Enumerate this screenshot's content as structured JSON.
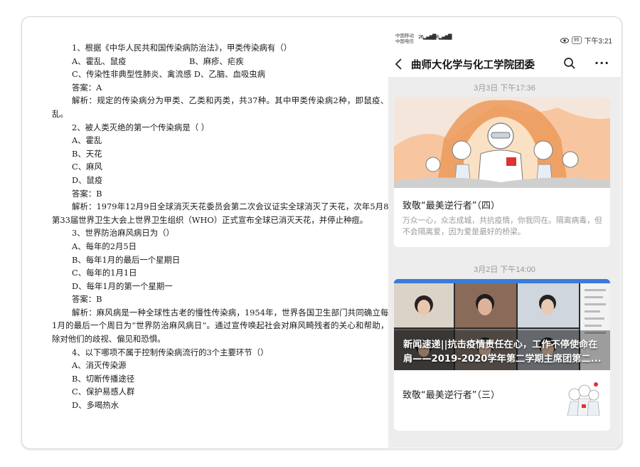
{
  "document": {
    "lines": [
      {
        "t": "1、根据《中华人民共和国传染病防治法》，甲类传染病有（）",
        "indent": true
      },
      {
        "t": "A、霍乱、鼠疫",
        "t2": "B、麻疹、疟疾",
        "indent": true
      },
      {
        "t": "C、传染性非典型性肺炎、禽流感    D、乙脑、血吸虫病",
        "indent": true
      },
      {
        "t": "答案：A",
        "indent": true
      },
      {
        "t": "解析：规定的传染病分为甲类、乙类和丙类，共37种。其中甲类传染病2种，即鼠疫、霍乱。",
        "wrap": true
      },
      {
        "t": "2、被人类灭绝的第一个传染病是（ ）",
        "indent": true
      },
      {
        "t": "A、霍乱",
        "indent": true
      },
      {
        "t": "B、天花",
        "indent": true
      },
      {
        "t": "C、麻风",
        "indent": true
      },
      {
        "t": "D、鼠疫",
        "indent": true
      },
      {
        "t": "答案：B",
        "indent": true
      },
      {
        "t": "解析：1979年12月9日全球消灭天花委员会第二次会议证实全球消灭了天花，次年5月8日第33届世界卫生大会上世界卫生组织（WHO）正式宣布全球已消灭天花，并停止种痘。",
        "wrap": true
      },
      {
        "t": "3、世界防治麻风病日为（）",
        "indent": true
      },
      {
        "t": "A、每年的2月5日",
        "indent": true
      },
      {
        "t": "B、每年1月的最后一个星期日",
        "indent": true
      },
      {
        "t": "C、每年的1月1日",
        "indent": true
      },
      {
        "t": "D、每年1月的第一个星期一",
        "indent": true
      },
      {
        "t": "答案：B",
        "indent": true
      },
      {
        "t": "解析：麻风病是一种全球性古老的慢性传染病，1954年，世界各国卫生部门共同确立每年1月的最后一个周日为“世界防治麻风病日”。通过宣传唤起社会对麻风畸残者的关心和帮助，消除对他们的歧视、偏见和恐惧。",
        "wrap": true
      },
      {
        "t": "4、以下哪项不属于控制传染病流行的3个主要环节（）",
        "indent": true
      },
      {
        "t": "A、消灭传染源",
        "indent": true
      },
      {
        "t": "B、切断传播途径",
        "indent": true
      },
      {
        "t": "C、保护易感人群",
        "indent": true
      },
      {
        "t": "D、多喝热水",
        "indent": true
      }
    ]
  },
  "phone": {
    "status": {
      "carrier1": "中国移动",
      "carrier2": "中国电信",
      "net1": "26",
      "net2": "46",
      "battery": "95",
      "time": "下午3:21"
    },
    "title": "曲师大化学与化工学院团委",
    "feed": {
      "ts1": "3月3日 下午17:36",
      "card1_title": "致敬“最美逆行者”（四）",
      "card1_desc": "万众一心，众志成城，共抗疫情，你我同在。隔离病毒，但不会隔离爱，因为爱是最好的桥梁。",
      "ts2": "3月2日 下午14:00",
      "card2_caption": "新闻速递||抗击疫情责任在心，工作不停使命在肩——2019-2020学年第二学期主席团第二...",
      "card2_sub_title": "致敬“最美逆行者”（三）"
    }
  },
  "colors": {
    "accent": "#2b6cdb",
    "feed_bg": "#ededed"
  }
}
